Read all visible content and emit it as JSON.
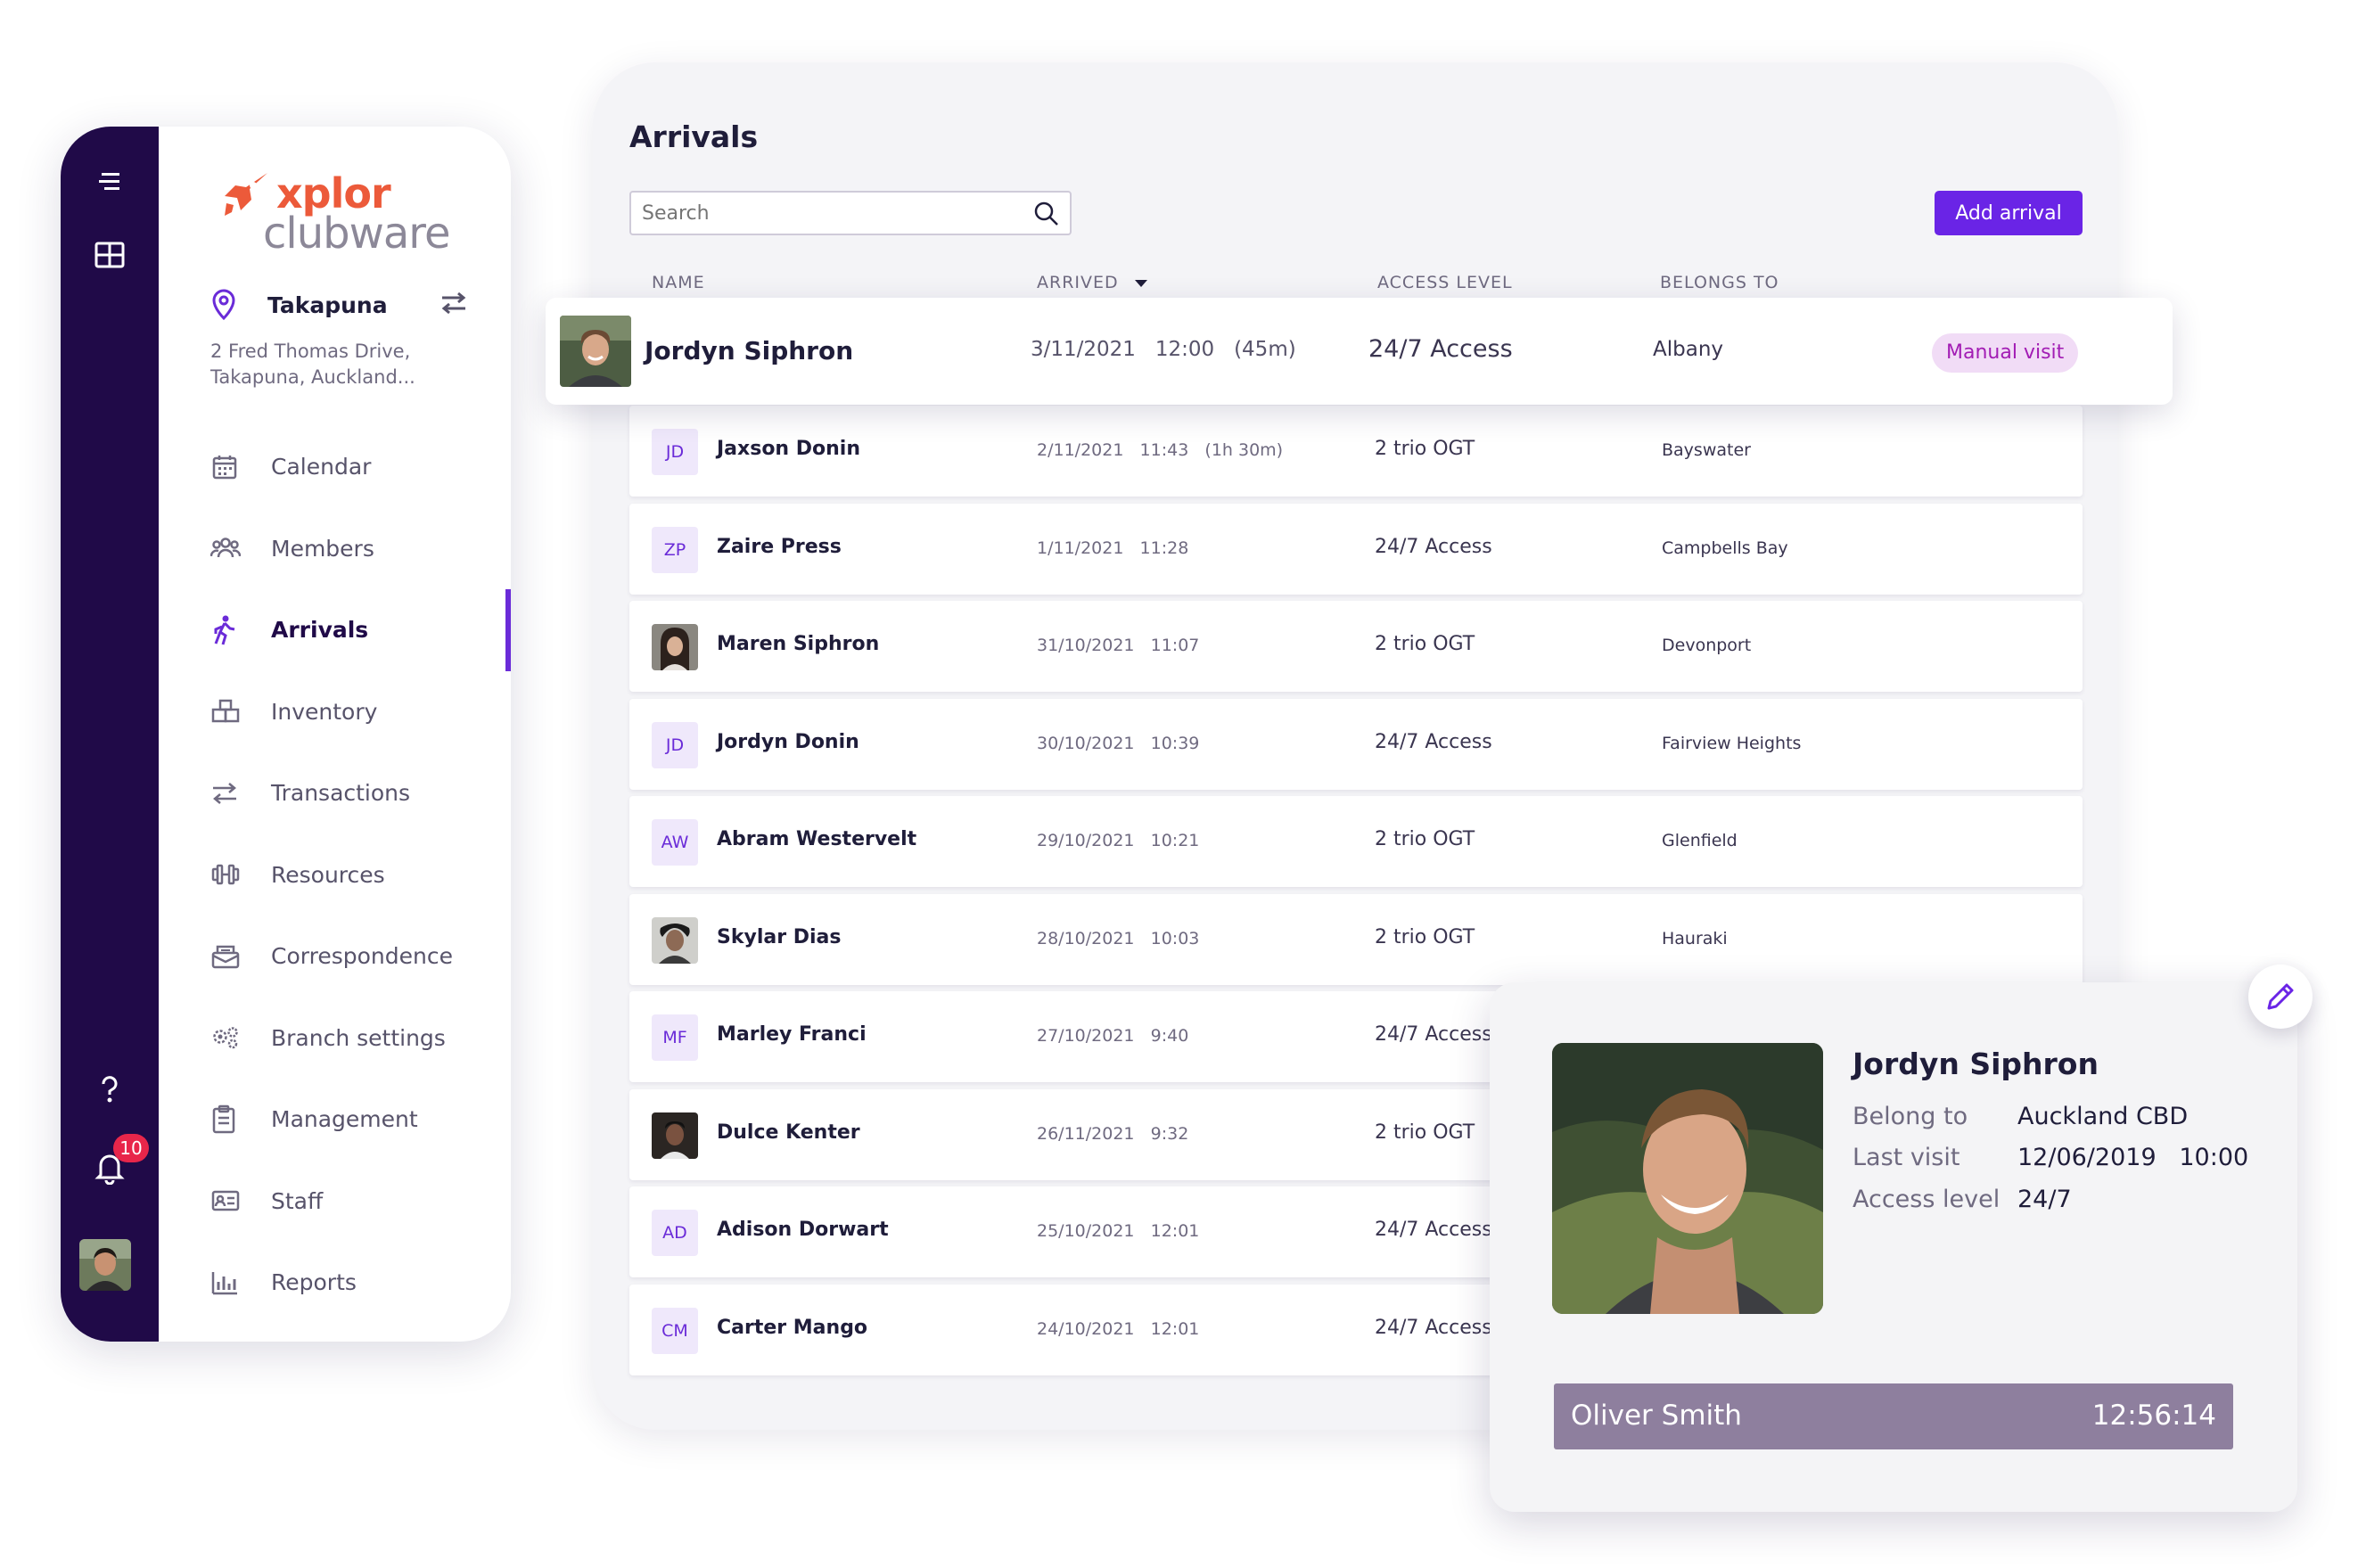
{
  "brand": {
    "word1": "xplor",
    "word2": "clubware"
  },
  "location": {
    "name": "Takapuna",
    "address_line1": "2 Fred Thomas Drive,",
    "address_line2": "Takapuna, Auckland..."
  },
  "sidebar": {
    "items": [
      {
        "label": "Calendar",
        "icon": "calendar-icon"
      },
      {
        "label": "Members",
        "icon": "members-icon"
      },
      {
        "label": "Arrivals",
        "icon": "arrivals-icon",
        "active": true
      },
      {
        "label": "Inventory",
        "icon": "inventory-icon"
      },
      {
        "label": "Transactions",
        "icon": "transactions-icon"
      },
      {
        "label": "Resources",
        "icon": "resources-icon"
      },
      {
        "label": "Correspondence",
        "icon": "correspondence-icon"
      },
      {
        "label": "Branch settings",
        "icon": "branch-settings-icon"
      },
      {
        "label": "Management",
        "icon": "management-icon"
      },
      {
        "label": "Staff",
        "icon": "staff-icon"
      },
      {
        "label": "Reports",
        "icon": "reports-icon"
      }
    ]
  },
  "rail": {
    "notification_count": "10"
  },
  "arrivals": {
    "title": "Arrivals",
    "search_placeholder": "Search",
    "add_button": "Add arrival",
    "columns": {
      "name": "NAME",
      "arrived": "ARRIVED",
      "access": "ACCESS LEVEL",
      "belongs": "BELONGS TO"
    },
    "highlighted": {
      "name": "Jordyn Siphron",
      "arrived": "3/11/2021   12:00   (45m)",
      "access": "24/7 Access",
      "belongs": "Albany",
      "tag": "Manual visit"
    },
    "rows": [
      {
        "name": "Jaxson Donin",
        "initials": "JD",
        "arrived": "2/11/2021   11:43   (1h 30m)",
        "access": "2 trio OGT",
        "belongs": "Bayswater"
      },
      {
        "name": "Zaire Press",
        "initials": "ZP",
        "arrived": "1/11/2021   11:28",
        "access": "24/7 Access",
        "belongs": "Campbells Bay"
      },
      {
        "name": "Maren Siphron",
        "initials": "",
        "arrived": "31/10/2021   11:07",
        "access": "2 trio OGT",
        "belongs": "Devonport"
      },
      {
        "name": "Jordyn Donin",
        "initials": "JD",
        "arrived": "30/10/2021   10:39",
        "access": "24/7 Access",
        "belongs": "Fairview Heights"
      },
      {
        "name": "Abram Westervelt",
        "initials": "AW",
        "arrived": "29/10/2021   10:21",
        "access": "2 trio OGT",
        "belongs": "Glenfield"
      },
      {
        "name": "Skylar Dias",
        "initials": "",
        "arrived": "28/10/2021   10:03",
        "access": "2 trio OGT",
        "belongs": "Hauraki"
      },
      {
        "name": "Marley Franci",
        "initials": "MF",
        "arrived": "27/10/2021   9:40",
        "access": "24/7 Access",
        "belongs": ""
      },
      {
        "name": "Dulce Kenter",
        "initials": "",
        "arrived": "26/11/2021   9:32",
        "access": "2 trio OGT",
        "belongs": ""
      },
      {
        "name": "Adison Dorwart",
        "initials": "AD",
        "arrived": "25/10/2021   12:01",
        "access": "24/7 Access",
        "belongs": ""
      },
      {
        "name": "Carter Mango",
        "initials": "CM",
        "arrived": "24/10/2021   12:01",
        "access": "24/7 Access",
        "belongs": ""
      }
    ]
  },
  "member_card": {
    "name": "Jordyn Siphron",
    "belong_label": "Belong to",
    "belong_value": "Auckland CBD",
    "last_visit_label": "Last visit",
    "last_visit_value": "12/06/2019   10:00",
    "access_label": "Access level",
    "access_value": "24/7",
    "staff_name": "Oliver Smith",
    "staff_time": "12:56:14"
  },
  "colors": {
    "accent": "#6a24e6",
    "rail": "#200a48",
    "brand_orange": "#ec5a3a",
    "tag_bg": "#f1dcf6",
    "tag_text": "#a21cb4",
    "badge": "#e8264a"
  }
}
